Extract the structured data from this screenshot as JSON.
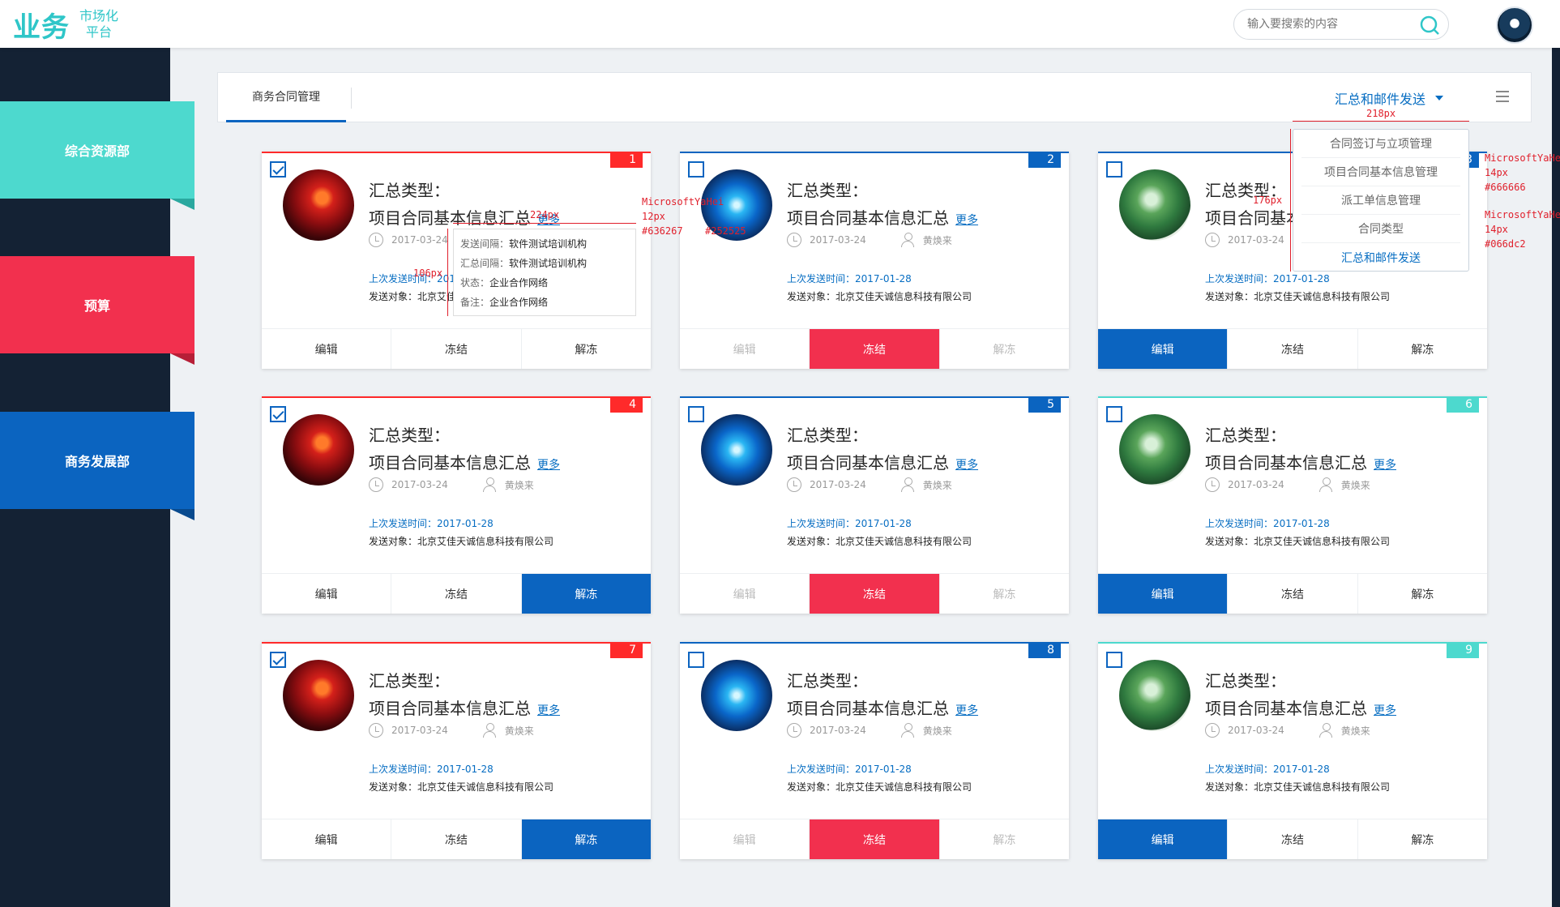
{
  "header": {
    "logo_mark": "业务",
    "logo_line1": "市场化",
    "logo_line2": "平台",
    "search_placeholder": "输入要搜索的内容"
  },
  "sidebar": {
    "items": [
      {
        "label": "综合资源部",
        "color": "#4dd9ce"
      },
      {
        "label": "预算",
        "color": "#f2304e"
      },
      {
        "label": "商务发展部",
        "color": "#0b64c0"
      }
    ]
  },
  "tabs": {
    "active": "商务合同管理",
    "dropdown_label": "汇总和邮件发送"
  },
  "dropdown_menu": {
    "items": [
      "合同签订与立项管理",
      "项目合同基本信息管理",
      "派工单信息管理",
      "合同类型",
      "汇总和邮件发送"
    ],
    "active_index": 4
  },
  "popup": {
    "rows": [
      {
        "k": "发送间隔：",
        "v": "软件测试培训机构"
      },
      {
        "k": "汇总间隔：",
        "v": "软件测试培训机构"
      },
      {
        "k": "状态：",
        "v": "企业合作网络"
      },
      {
        "k": "备注：",
        "v": "企业合作网络"
      }
    ]
  },
  "card_text": {
    "label1": "汇总类型：",
    "label2": "项目合同基本信息汇总",
    "more": "更多",
    "date": "2017-03-24",
    "person": "黄焕来",
    "sendtime": "上次发送时间：2017-01-28",
    "target": "发送对象：北京艾佳天诚信息科技有限公司",
    "btn_edit": "编辑",
    "btn_freeze": "冻结",
    "btn_unfreeze": "解冻"
  },
  "cards": [
    {
      "num": "1",
      "accent": "#ff2a2a",
      "checked": true,
      "image": "red"
    },
    {
      "num": "2",
      "accent": "#0b64c0",
      "checked": false,
      "image": "blue"
    },
    {
      "num": "3",
      "accent": "#0b64c0",
      "checked": false,
      "image": "green"
    },
    {
      "num": "4",
      "accent": "#ff2a2a",
      "checked": true,
      "image": "red"
    },
    {
      "num": "5",
      "accent": "#0b64c0",
      "checked": false,
      "image": "blue"
    },
    {
      "num": "6",
      "accent": "#4dd9ce",
      "checked": false,
      "image": "green"
    },
    {
      "num": "7",
      "accent": "#ff2a2a",
      "checked": true,
      "image": "red"
    },
    {
      "num": "8",
      "accent": "#0b64c0",
      "checked": false,
      "image": "blue"
    },
    {
      "num": "9",
      "accent": "#4dd9ce",
      "checked": false,
      "image": "green"
    }
  ],
  "annotations": {
    "w218": "218px",
    "w224": "224px",
    "h106": "106px",
    "h176": "176px",
    "font_a": "MicrosoftYaHei",
    "size_a": "12px",
    "color_a1": "#636267",
    "color_a2": "#252525",
    "font_b": "MicrosoftYaHei",
    "size_b": "14px",
    "color_b": "#666666",
    "font_c": "MicrosoftYaHei",
    "size_c": "14px",
    "color_c": "#066dc2"
  }
}
